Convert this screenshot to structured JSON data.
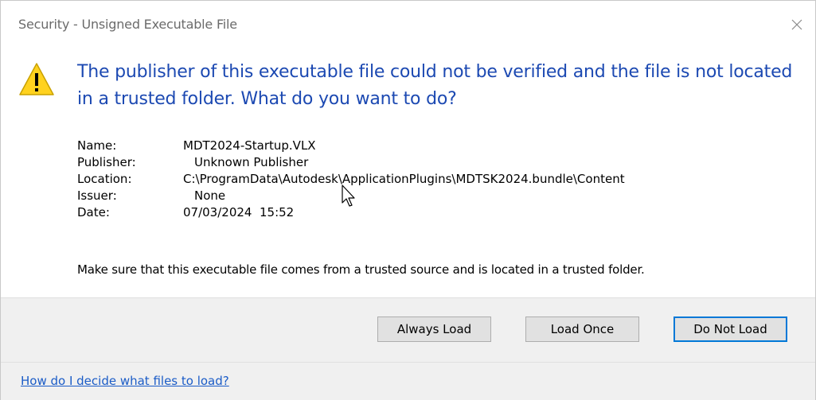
{
  "window": {
    "title": "Security - Unsigned Executable File"
  },
  "message": {
    "headline": "The publisher of this executable file could not be verified and the file is not located in a trusted folder. What do you want to do?"
  },
  "details": [
    {
      "label": "Name:",
      "value": "MDT2024-Startup.VLX"
    },
    {
      "label": "Publisher:",
      "value": "Unknown Publisher"
    },
    {
      "label": "Location:",
      "value": "C:\\ProgramData\\Autodesk\\ApplicationPlugins\\MDTSK2024.bundle\\Content"
    },
    {
      "label": "Issuer:",
      "value": "None"
    },
    {
      "label": "Date:",
      "value": "07/03/2024  15:52"
    }
  ],
  "note": "Make sure that this executable file comes from a trusted source and is located in a trusted folder.",
  "buttons": {
    "always_load": "Always Load",
    "load_once": "Load Once",
    "do_not_load": "Do Not Load"
  },
  "footer": {
    "help_link": "How do I decide what files to load?"
  },
  "icons": {
    "warning": "warning-icon",
    "close": "close-icon",
    "cursor": "mouse-cursor-icon"
  },
  "colors": {
    "headline": "#1c49b2",
    "link": "#1b5cc7",
    "default_button_border": "#0078d7",
    "warning_fill": "#ffd21f"
  }
}
